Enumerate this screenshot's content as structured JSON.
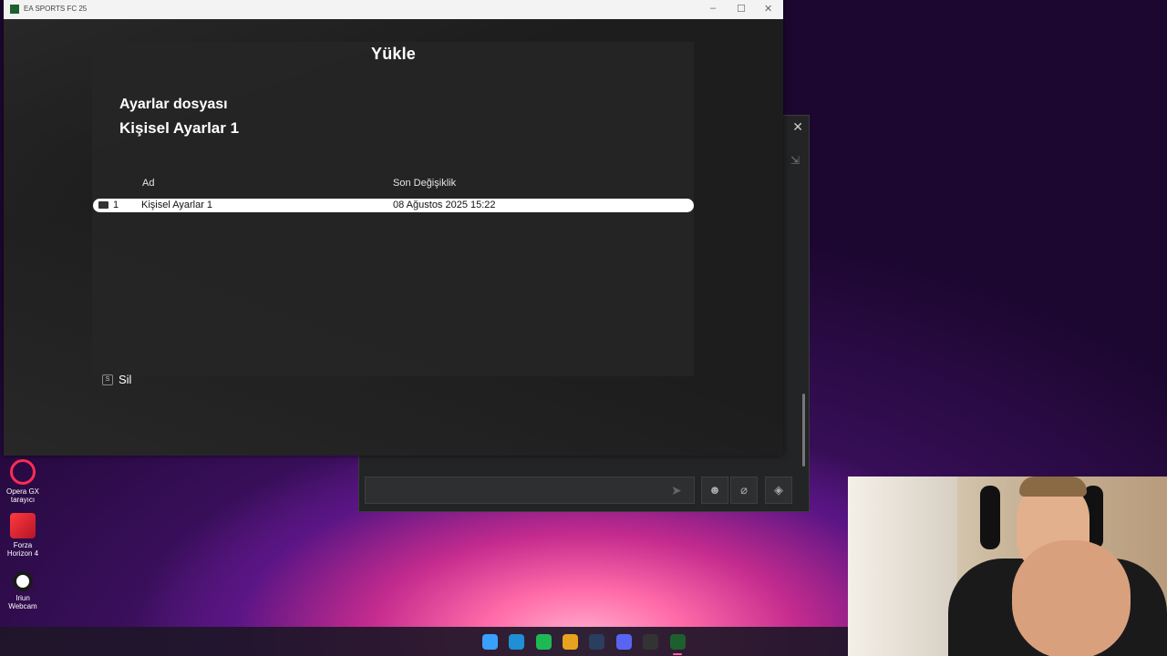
{
  "window": {
    "title": "EA SPORTS FC 25",
    "minimize": "–",
    "maximize": "☐",
    "close": "✕"
  },
  "screen": {
    "title": "Yükle",
    "file_label": "Ayarlar dosyası",
    "file_name": "Kişisel Ayarlar 1",
    "columns": {
      "name": "Ad",
      "modified": "Son Değişiklik"
    },
    "rows": [
      {
        "num": "1",
        "name": "Kişisel Ayarlar 1",
        "date": "08 Ağustos 2025 15:22",
        "selected": true
      }
    ],
    "delete_key": "S",
    "delete_label": "Sil"
  },
  "chat": {
    "close": "✕",
    "send_icon": "send-icon",
    "emoji_icon": "emoji-icon",
    "attach_icon": "paperclip-icon",
    "gift_icon": "gift-icon"
  },
  "desktop_icons": [
    {
      "label1": "Opera GX",
      "label2": "tarayıcı",
      "icon": "opera-gx-icon"
    },
    {
      "label1": "Forza",
      "label2": "Horizon 4",
      "icon": "forza-icon"
    },
    {
      "label1": "Iriun",
      "label2": "Webcam",
      "icon": "iriun-webcam-icon"
    }
  ],
  "taskbar": {
    "icons": [
      "windows-start-icon",
      "edge-icon",
      "spotify-icon",
      "chrome-icon",
      "steam-icon",
      "discord-icon",
      "obs-icon",
      "ea-fc-icon"
    ],
    "colors": [
      "#3aa0ff",
      "#1f8fd6",
      "#1db954",
      "#e8a21f",
      "#2a3f5f",
      "#5865f2",
      "#333333",
      "#1d5f2e"
    ]
  },
  "colors": {
    "accent": "#ff5fa2",
    "selected_row": "#ffffff"
  }
}
